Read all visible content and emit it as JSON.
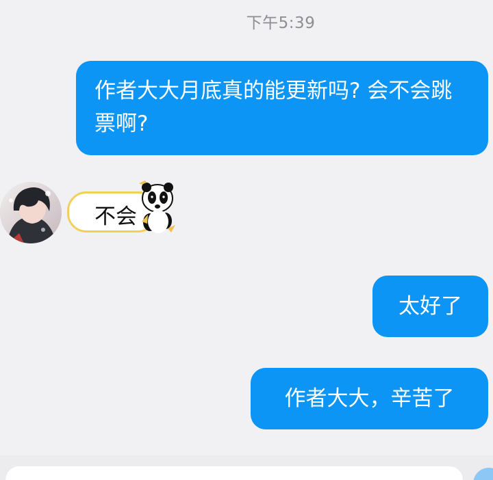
{
  "chat": {
    "timestamp": "下午5:39",
    "messages": [
      {
        "side": "right",
        "kind": "text",
        "text": "作者大大月底真的能更新吗? 会不会跳票啊?"
      },
      {
        "side": "left",
        "kind": "sticker",
        "text": "不会",
        "sticker_icon": "panda-sticker-icon"
      },
      {
        "side": "right",
        "kind": "text",
        "text": "太好了"
      },
      {
        "side": "right",
        "kind": "text",
        "text": "作者大大，辛苦了"
      }
    ]
  },
  "input": {
    "placeholder": ""
  },
  "colors": {
    "background": "#f1f1f3",
    "outgoing_bubble": "#0d95f6",
    "timestamp": "#8d8d93",
    "sticker_border": "#f2cf59"
  },
  "icons": {
    "avatar": "avatar-photo",
    "send_button": "send-button-icon"
  }
}
